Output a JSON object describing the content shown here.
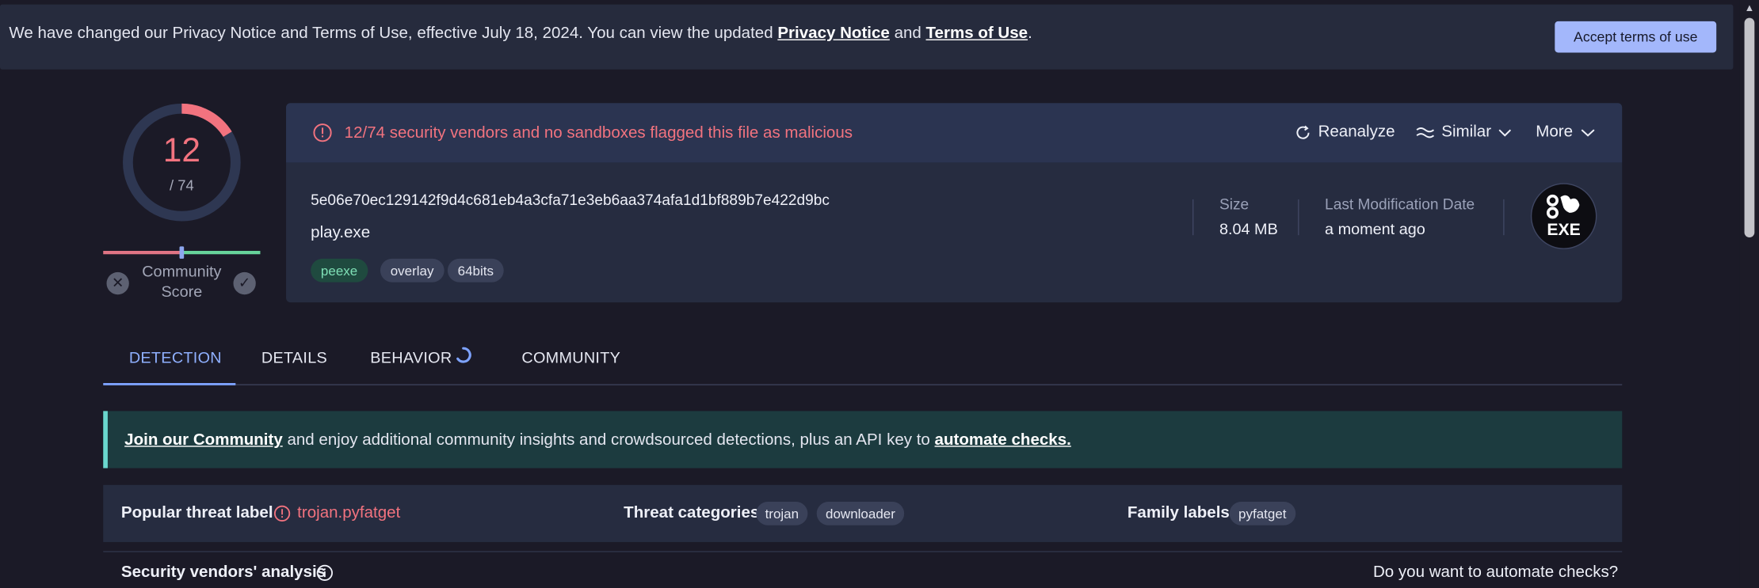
{
  "privacy_banner": {
    "text_before": "We have changed our Privacy Notice and Terms of Use, effective July 18, 2024. You can view the updated ",
    "privacy_link": "Privacy Notice",
    "text_middle": " and ",
    "terms_link": "Terms of Use",
    "text_after": ".",
    "accept_label": "Accept terms of use"
  },
  "score": {
    "detections": "12",
    "total": "/ 74",
    "detection_fraction": 0.162,
    "community_label": "Community Score",
    "community_fraction": 0.5
  },
  "summary": {
    "detection_text": "12/74 security vendors and no sandboxes flagged this file as malicious",
    "reanalyze_label": "Reanalyze",
    "similar_label": "Similar",
    "more_label": "More",
    "hash": "5e06e70ec129142f9d4c681eb4a3cfa71e3eb6aa374afa1d1bf889b7e422d9bc",
    "file_name": "play.exe",
    "tags": [
      "peexe",
      "overlay",
      "64bits"
    ],
    "size_label": "Size",
    "size_value": "8.04 MB",
    "date_label": "Last Modification Date",
    "date_value": "a moment ago",
    "file_type_icon_text": "EXE"
  },
  "tabs": [
    "DETECTION",
    "DETAILS",
    "BEHAVIOR",
    "COMMUNITY"
  ],
  "community_banner": {
    "link_join": "Join our Community",
    "text_middle": " and enjoy additional community insights and crowdsourced detections, plus an API key to ",
    "link_automate": "automate checks."
  },
  "threat": {
    "popular_label": "Popular threat label",
    "popular_value": "trojan.pyfatget",
    "categories_label": "Threat categories",
    "categories": [
      "trojan",
      "downloader"
    ],
    "family_label": "Family labels",
    "families": [
      "pyfatget"
    ]
  },
  "vendors": {
    "title": "Security vendors' analysis",
    "automate_question": "Do you want to automate checks?"
  },
  "colors": {
    "malicious": "#f2737f",
    "accent": "#8fb0ff",
    "accept_button": "#a3b7fb",
    "tag_peexe_bg": "#1f4a3f",
    "tag_peexe_text": "#7fe0b6"
  }
}
